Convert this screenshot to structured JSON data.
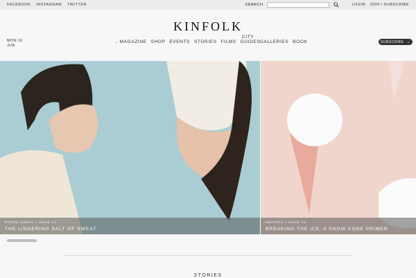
{
  "topbar": {
    "social": [
      "FACEBOOK",
      "INSTAGRAM",
      "TWITTER"
    ],
    "search_label": "SEARCH",
    "search_placeholder": "",
    "login": "LOGIN",
    "join": "JOIN / SUBSCRIBE"
  },
  "header": {
    "logo": "KINFOLK",
    "date_line1": "MON 16",
    "date_line2": "JUN",
    "nav": [
      "MAGAZINE",
      "SHOP",
      "EVENTS",
      "STORIES",
      "FILMS",
      "CITY",
      "GUIDES",
      "GALLERIES",
      "BOOK"
    ],
    "subscribe": "SUBSCRIBE"
  },
  "hero": [
    {
      "kicker": "PHOTO ESSAY  |  ISSUE 12",
      "title": "THE LINGERING SALT OF SWEAT"
    },
    {
      "kicker": "RECIPES  |  ISSUE 12",
      "title": "BREAKING THE ICE: A SNOW CONE PRIMER"
    }
  ],
  "section": {
    "title": "STORIES"
  },
  "colors": {
    "accent_dark": "#333333",
    "hero_bg_left": "#a9cdd3",
    "hero_bg_right": "#f0d5cc"
  }
}
